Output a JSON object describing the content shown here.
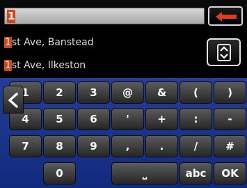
{
  "search": {
    "typed": "1"
  },
  "results": [
    {
      "highlight": "1",
      "rest": "st Ave, Banstead"
    },
    {
      "highlight": "1",
      "rest": "st Ave, Ilkeston"
    }
  ],
  "keyboard": {
    "rows": [
      [
        "1",
        "2",
        "3",
        "@",
        "&",
        "(",
        ")"
      ],
      [
        "4",
        "5",
        "6",
        "'",
        "+",
        ":",
        "-"
      ],
      [
        "7",
        "8",
        "9",
        ",",
        ".",
        "/",
        "#"
      ]
    ],
    "bottom": {
      "zero": "0",
      "space": "⎵",
      "abc": "abc",
      "ok": "OK"
    }
  },
  "icons": {
    "backspace": "left-arrow-icon",
    "scroll": "chevron-up-down-icon",
    "back": "chevron-left-icon"
  },
  "colors": {
    "highlight": "#d2451d",
    "keyboard_bg": "#1c3590",
    "key": "#3d3d3d"
  }
}
